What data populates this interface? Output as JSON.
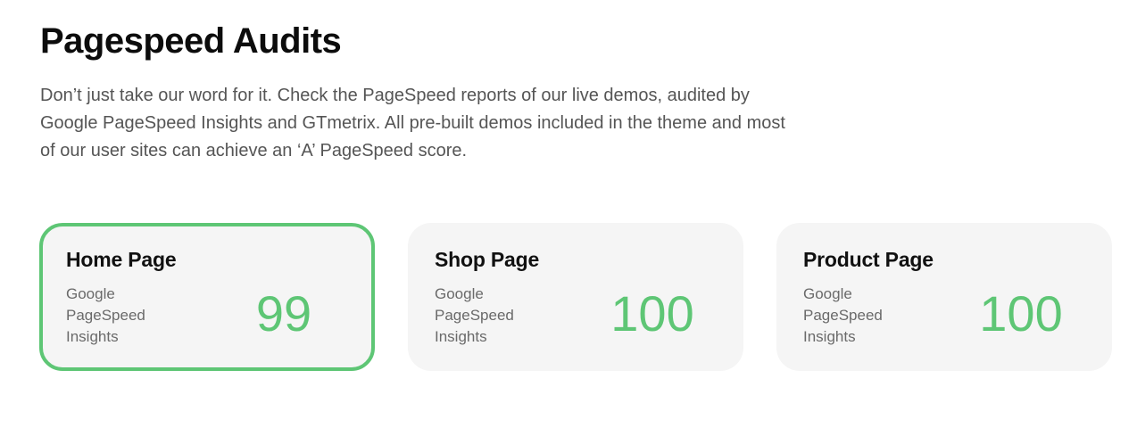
{
  "header": {
    "title": "Pagespeed Audits",
    "intro": "Don’t just take our word for it. Check the PageSpeed reports of our live demos, audited by Google PageSpeed Insights and GTmetrix. All pre-built demos included in the theme and most of our user sites can achieve an ‘A’ PageSpeed score."
  },
  "cards": [
    {
      "title": "Home Page",
      "source": "Google PageSpeed Insights",
      "score": "99"
    },
    {
      "title": "Shop Page",
      "source": "Google PageSpeed Insights",
      "score": "100"
    },
    {
      "title": "Product Page",
      "source": "Google PageSpeed Insights",
      "score": "100"
    }
  ],
  "colors": {
    "accent": "#5ec675",
    "card_background": "#f5f5f5",
    "body_text": "#555555"
  }
}
